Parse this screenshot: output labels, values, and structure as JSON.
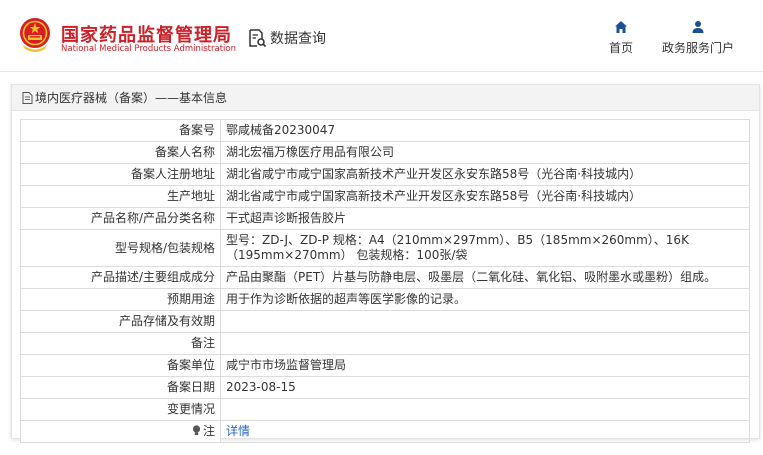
{
  "header": {
    "title": "国家药品监督管理局",
    "subtitle": "National Medical Products Administration",
    "query_label": "数据查询",
    "nav": [
      {
        "label": "首页",
        "icon": "home-icon"
      },
      {
        "label": "政务服务门户",
        "icon": "user-icon"
      }
    ],
    "brand_color": "#cc1f27"
  },
  "panel": {
    "breadcrumb": "境内医疗器械（备案）——基本信息"
  },
  "record": {
    "rows": [
      {
        "label": "备案号",
        "value": "鄂咸械备20230047"
      },
      {
        "label": "备案人名称",
        "value": "湖北宏福万橡医疗用品有限公司"
      },
      {
        "label": "备案人注册地址",
        "value": "湖北省咸宁市咸宁国家高新技术产业开发区永安东路58号（光谷南·科技城内）"
      },
      {
        "label": "生产地址",
        "value": "湖北省咸宁市咸宁国家高新技术产业开发区永安东路58号（光谷南·科技城内）"
      },
      {
        "label": "产品名称/产品分类名称",
        "value": "干式超声诊断报告胶片"
      },
      {
        "label": "型号规格/包装规格",
        "value": "型号：ZD-J、ZD-P 规格：A4（210mm×297mm）、B5（185mm×260mm）、16K（195mm×270mm） 包装规格：100张/袋"
      },
      {
        "label": "产品描述/主要组成成分",
        "value": "产品由聚酯（PET）片基与防静电层、吸墨层（二氧化硅、氧化铝、吸附墨水或墨粉）组成。"
      },
      {
        "label": "预期用途",
        "value": "用于作为诊断依据的超声等医学影像的记录。"
      },
      {
        "label": "产品存储及有效期",
        "value": ""
      },
      {
        "label": "备注",
        "value": ""
      },
      {
        "label": "备案单位",
        "value": "咸宁市市场监督管理局"
      },
      {
        "label": "备案日期",
        "value": "2023-08-15"
      },
      {
        "label": "变更情况",
        "value": ""
      }
    ],
    "note_label": "注",
    "note_link": "详情"
  }
}
